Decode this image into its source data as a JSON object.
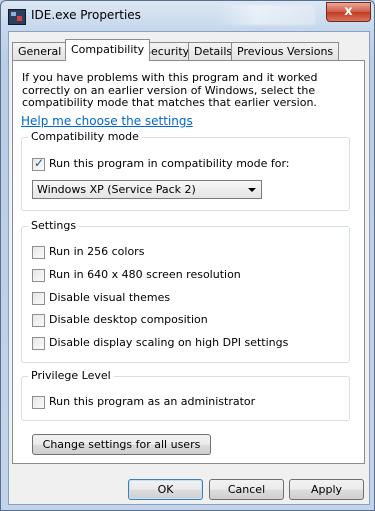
{
  "window": {
    "title": "IDE.exe Properties",
    "close_label": "x"
  },
  "tabs": [
    {
      "label": "General",
      "active": false
    },
    {
      "label": "Compatibility",
      "active": true
    },
    {
      "label": "Security",
      "active": false
    },
    {
      "label": "Details",
      "active": false
    },
    {
      "label": "Previous Versions",
      "active": false
    }
  ],
  "intro": "If you have problems with this program and it worked correctly on an earlier version of Windows, select the compatibility mode that matches that earlier version.",
  "help_link": "Help me choose the settings",
  "compat_mode": {
    "label": "Compatibility mode",
    "checkbox_label": "Run this program in compatibility mode for:",
    "checked": true,
    "selected_mode": "Windows XP (Service Pack 2)"
  },
  "settings": {
    "label": "Settings",
    "options": [
      {
        "label": "Run in 256 colors",
        "checked": false
      },
      {
        "label": "Run in 640 x 480 screen resolution",
        "checked": false
      },
      {
        "label": "Disable visual themes",
        "checked": false
      },
      {
        "label": "Disable desktop composition",
        "checked": false
      },
      {
        "label": "Disable display scaling on high DPI settings",
        "checked": false
      }
    ]
  },
  "privilege": {
    "label": "Privilege Level",
    "checkbox_label": "Run this program as an administrator",
    "checked": false
  },
  "change_all_users": "Change settings for all users",
  "buttons": {
    "ok": "OK",
    "cancel": "Cancel",
    "apply": "Apply"
  }
}
